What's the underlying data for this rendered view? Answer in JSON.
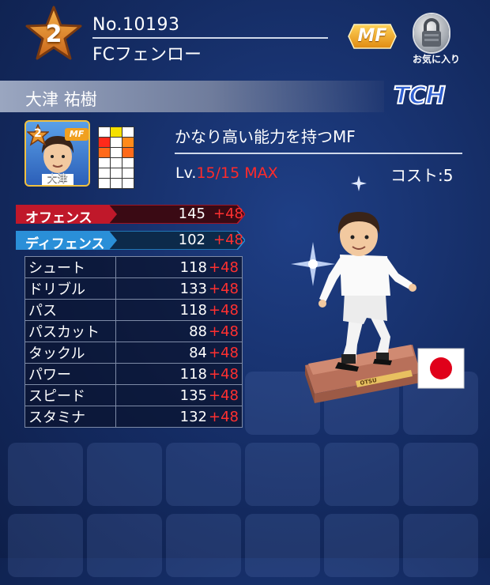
{
  "header": {
    "rarity": "2",
    "card_no": "No.10193",
    "club": "FCフェンロー",
    "position": "MF",
    "favorite_label": "お気に入り"
  },
  "player": {
    "name": "大津 祐樹",
    "short_name": "大津",
    "team_tag": "TCH",
    "description": "かなり高い能力を持つMF",
    "level_prefix": "Lv.",
    "level_value": "15/15 MAX",
    "cost": "コスト:5",
    "nationality_flag": "japan-flag-icon",
    "pedestal_label": "OTSU"
  },
  "main_stats": [
    {
      "label": "オフェンス",
      "value": "145",
      "bonus": "+48",
      "color": "#c0182a"
    },
    {
      "label": "ディフェンス",
      "value": "102",
      "bonus": "+48",
      "color": "#2a8fd8"
    }
  ],
  "stats": [
    {
      "label": "シュート",
      "value": "118",
      "bonus": "+48"
    },
    {
      "label": "ドリブル",
      "value": "133",
      "bonus": "+48"
    },
    {
      "label": "パス",
      "value": "118",
      "bonus": "+48"
    },
    {
      "label": "パスカット",
      "value": "88",
      "bonus": "+48"
    },
    {
      "label": "タックル",
      "value": "84",
      "bonus": "+48"
    },
    {
      "label": "パワー",
      "value": "118",
      "bonus": "+48"
    },
    {
      "label": "スピード",
      "value": "135",
      "bonus": "+48"
    },
    {
      "label": "スタミナ",
      "value": "132",
      "bonus": "+48"
    }
  ]
}
